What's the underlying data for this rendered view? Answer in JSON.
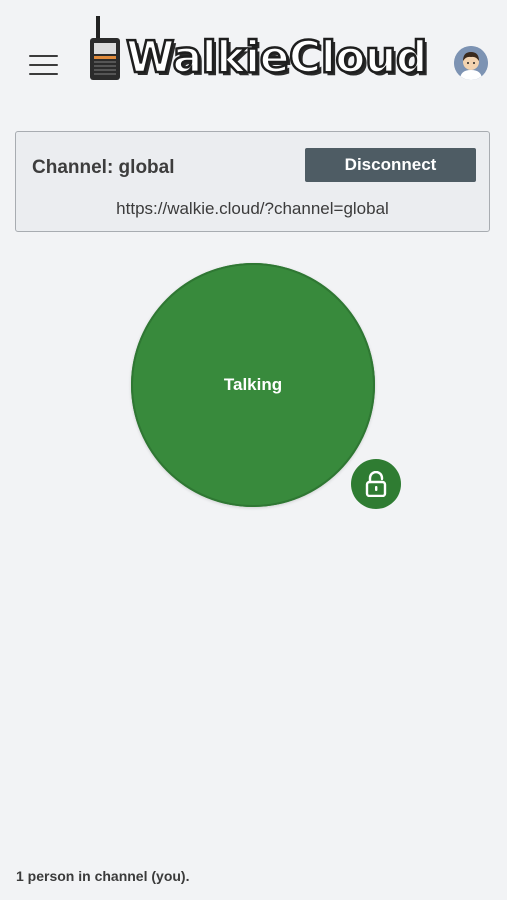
{
  "header": {
    "menu_icon": "hamburger-menu-icon",
    "logo_text": "WalkieCloud",
    "logo_icon": "walkie-talkie-icon",
    "avatar_icon": "user-avatar-icon"
  },
  "channel": {
    "label": "Channel: global",
    "disconnect_label": "Disconnect",
    "url": "https://walkie.cloud/?channel=global"
  },
  "talk": {
    "label": "Talking",
    "lock_icon": "unlock-icon"
  },
  "footer": {
    "status": "1 person in channel (you)."
  },
  "colors": {
    "background": "#f2f3f5",
    "talk_green": "#388a3c",
    "lock_green": "#2f7c32",
    "disconnect_bg": "#4e5c64"
  }
}
